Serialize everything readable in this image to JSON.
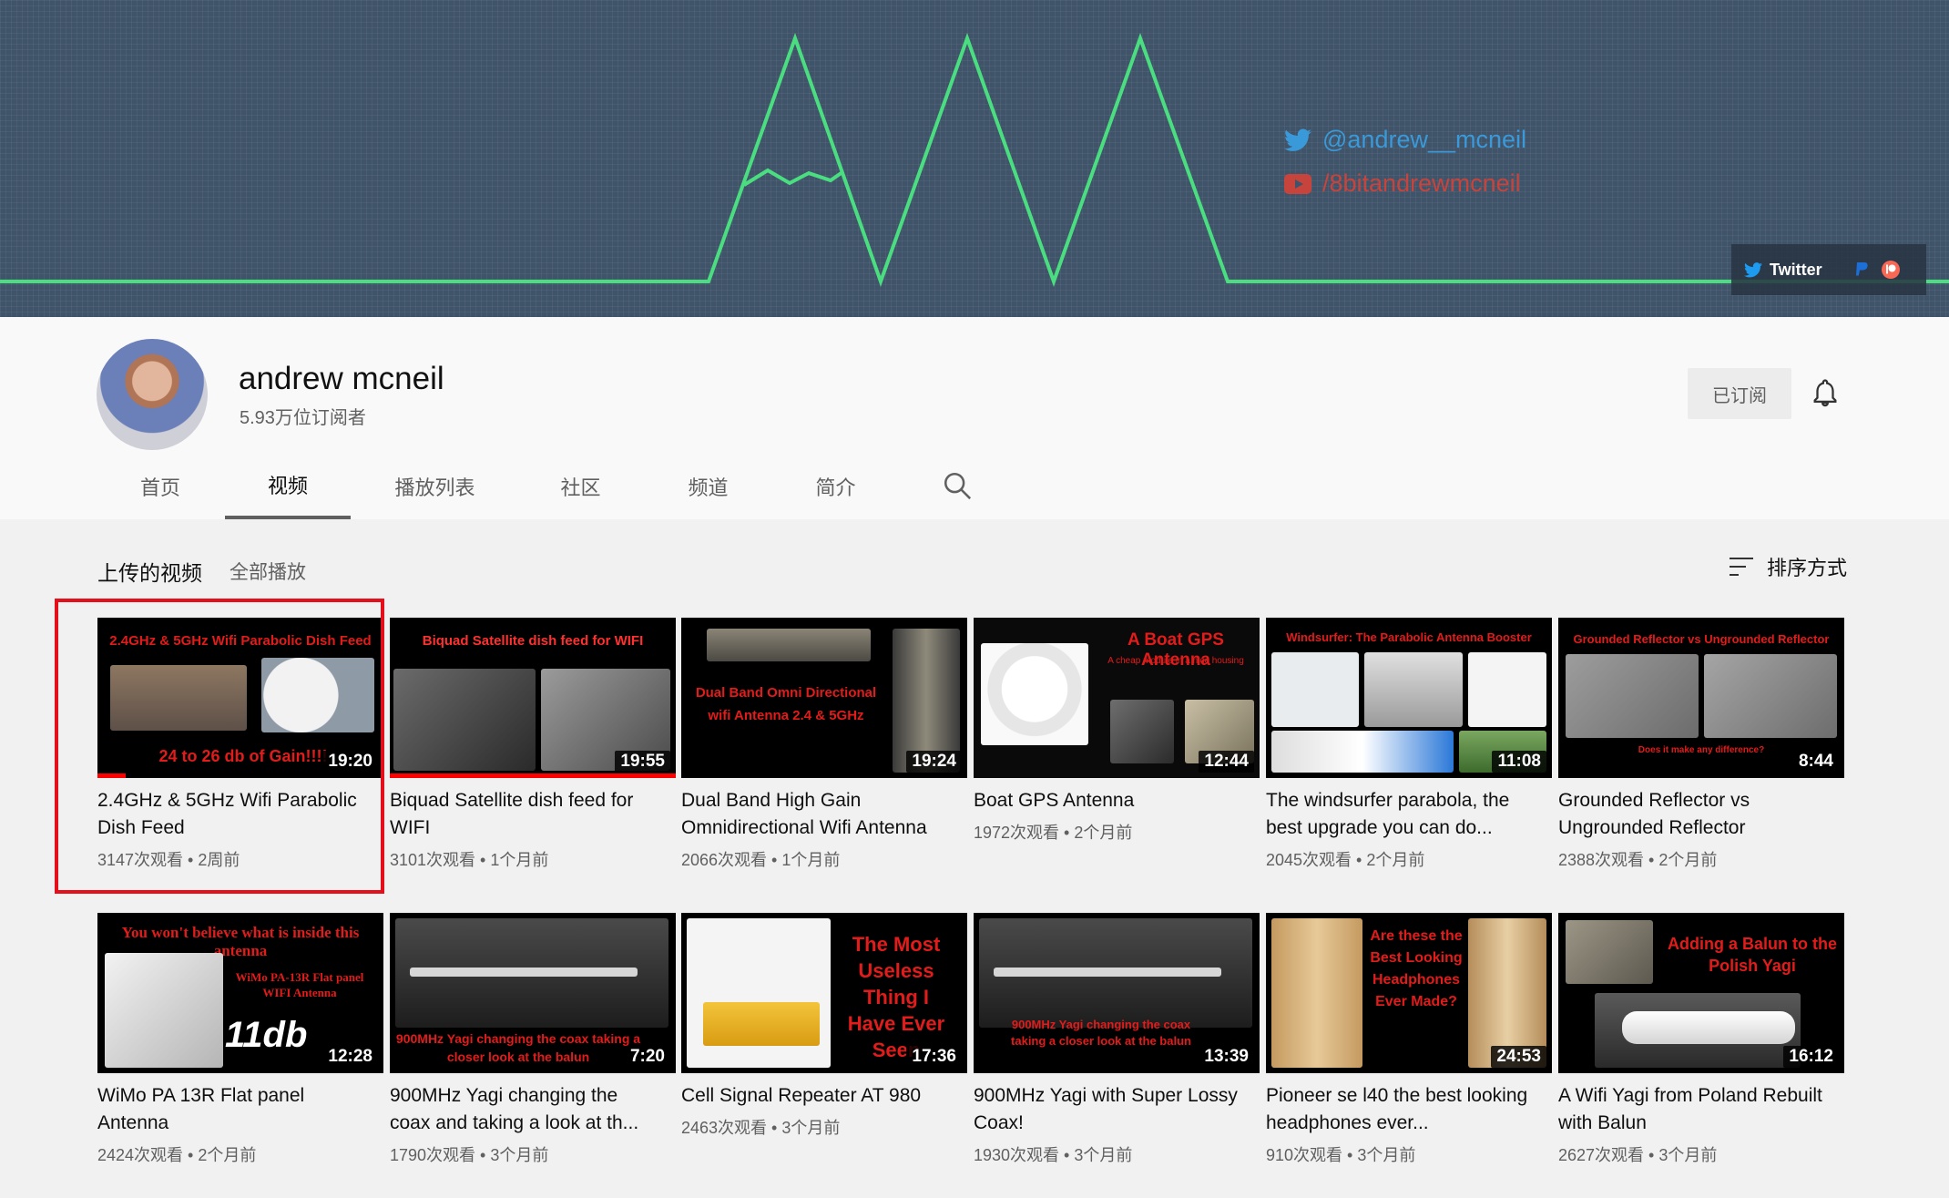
{
  "banner": {
    "twitter_handle": "@andrew__mcneil",
    "youtube_handle": "/8bitandrewmcneil",
    "twitter_button": "Twitter",
    "accent_color": "#4ade80"
  },
  "channel": {
    "name": "andrew mcneil",
    "subscribers": "5.93万位订阅者",
    "subscribed_label": "已订阅"
  },
  "tabs": [
    {
      "label": "首页"
    },
    {
      "label": "视频",
      "active": true
    },
    {
      "label": "播放列表"
    },
    {
      "label": "社区"
    },
    {
      "label": "频道"
    },
    {
      "label": "简介"
    }
  ],
  "section": {
    "title": "上传的视频",
    "play_all": "全部播放",
    "sort_label": "排序方式"
  },
  "videos": [
    {
      "title": "2.4GHz & 5GHz Wifi Parabolic Dish Feed",
      "duration": "19:20",
      "meta": "3147次观看 • 2周前",
      "thumb_top": "2.4GHz & 5GHz Wifi Parabolic Dish Feed",
      "thumb_mid": "24 to 26 db of Gain!!!!",
      "progress": 0.1
    },
    {
      "title": "Biquad Satellite dish feed for WIFI",
      "duration": "19:55",
      "meta": "3101次观看 • 1个月前",
      "thumb_top": "Biquad Satellite dish feed for WIFI",
      "progress": 1.0
    },
    {
      "title": "Dual Band High Gain Omnidirectional Wifi Antenna",
      "duration": "19:24",
      "meta": "2066次观看 • 1个月前",
      "thumb_mid": "Dual Band Omni Directional wifi Antenna 2.4 & 5GHz"
    },
    {
      "title": "Boat GPS Antenna",
      "duration": "12:44",
      "meta": "1972次观看 • 2个月前",
      "thumb_top": "A Boat GPS Antenna",
      "thumb_sub": "A cheap module in a nice housing"
    },
    {
      "title": "The windsurfer parabola, the best upgrade you can do...",
      "duration": "11:08",
      "meta": "2045次观看 • 2个月前",
      "thumb_top": "Windsurfer: The Parabolic Antenna Booster"
    },
    {
      "title": "Grounded Reflector vs Ungrounded Reflector",
      "duration": "8:44",
      "meta": "2388次观看 • 2个月前",
      "thumb_top": "Grounded Reflector vs Ungrounded Reflector",
      "thumb_sub": "Does it make any difference?"
    },
    {
      "title": "WiMo PA 13R Flat panel Antenna",
      "duration": "12:28",
      "meta": "2424次观看 • 2个月前",
      "thumb_top": "You won't believe what is inside this antenna",
      "thumb_mid": "WiMo PA-13R Flat panel WIFI Antenna",
      "thumb_big": "11db"
    },
    {
      "title": "900MHz Yagi changing the coax and taking a look at th...",
      "duration": "7:20",
      "meta": "1790次观看 • 3个月前",
      "thumb_mid": "900MHz Yagi changing the coax taking a closer look at the balun"
    },
    {
      "title": "Cell Signal Repeater AT 980",
      "duration": "17:36",
      "meta": "2463次观看 • 3个月前",
      "thumb_mid": "The Most Useless Thing I Have Ever Seen"
    },
    {
      "title": "900MHz Yagi with Super Lossy Coax!",
      "duration": "13:39",
      "meta": "1930次观看 • 3个月前",
      "thumb_mid": "900MHz Yagi changing the coax taking a closer look at the balun"
    },
    {
      "title": "Pioneer se l40 the best looking headphones ever...",
      "duration": "24:53",
      "meta": "910次观看 • 3个月前",
      "thumb_mid": "Are these the Best Looking Headphones Ever Made?"
    },
    {
      "title": "A Wifi Yagi from Poland Rebuilt with Balun",
      "duration": "16:12",
      "meta": "2627次观看 • 3个月前",
      "thumb_mid": "Adding a Balun to the Polish Yagi"
    }
  ]
}
